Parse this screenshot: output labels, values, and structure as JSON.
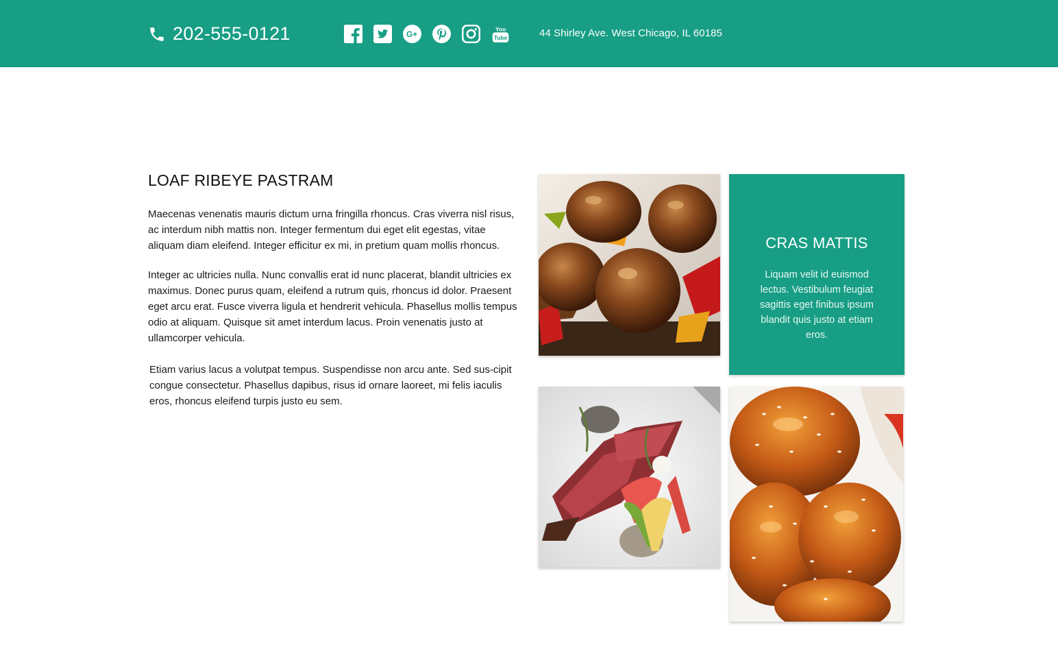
{
  "header": {
    "phone": "202-555-0121",
    "address": "44 Shirley Ave. West Chicago, IL 60185",
    "social_icons": [
      "facebook-icon",
      "twitter-icon",
      "google-plus-icon",
      "pinterest-icon",
      "instagram-icon",
      "youtube-icon"
    ],
    "accent_color": "#179e85"
  },
  "article": {
    "title": "LOAF RIBEYE PASTRAM",
    "paragraphs": [
      "Maecenas venenatis mauris dictum urna fringilla rhoncus. Cras viverra nisl risus, ac interdum nibh mattis non. Integer fermentum dui eget elit egestas, vitae aliquam diam eleifend. Integer efficitur ex mi, in pretium quam mollis rhoncus.",
      "Integer ac ultricies nulla. Nunc convallis erat id nunc placerat, blandit ultricies ex maximus. Donec purus quam, eleifend a rutrum quis, rhoncus id dolor. Praesent eget arcu erat. Fusce viverra ligula et hendrerit vehicula. Phasellus mollis tempus odio at aliquam. Quisque sit amet interdum lacus. Proin venenatis justo at ullamcorper vehicula.",
      "Etiam varius lacus a volutpat tempus. Suspendisse non arcu ante. Sed sus-cipit congue consectetur. Phasellus dapibus, risus id ornare laoreet, mi felis iaculis eros, rhoncus eleifend turpis justo eu sem."
    ]
  },
  "promo": {
    "title": "CRAS MATTIS",
    "text": "Liquam velit id euismod lectus. Vestibulum feugiat sagittis eget finibus ipsum blandit quis justo at etiam eros."
  },
  "gallery": [
    "meatballs-photo",
    "sliced-beef-photo",
    "glazed-chicken-photo"
  ]
}
